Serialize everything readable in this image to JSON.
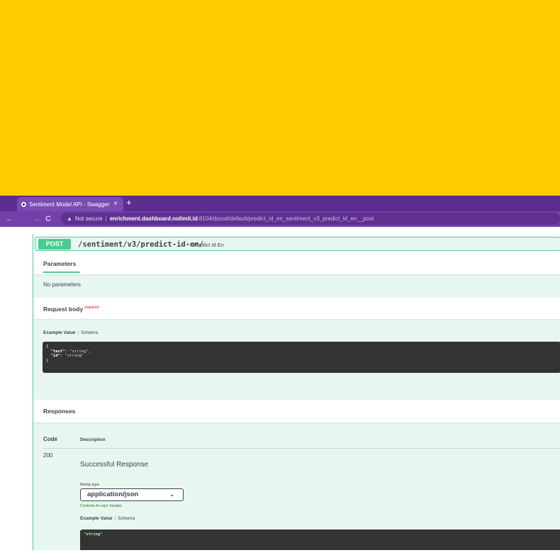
{
  "browser": {
    "tab_title": "Sentiment Model API - Swagger",
    "tab_close": "×",
    "new_tab": "+",
    "back": "←",
    "forward": "→",
    "reload": "C",
    "warning": "▲",
    "not_secure": "Not secure",
    "url_host": "enrichment.dashboard.nolimit.id",
    "url_path": ":8104/docs#/default/predict_id_en_sentiment_v3_predict_id_en__post"
  },
  "operation": {
    "method": "POST",
    "path": "/sentiment/v3/predict-id-en/",
    "summary": "Predict Id En"
  },
  "parameters": {
    "title": "Parameters",
    "empty_text": "No parameters"
  },
  "request_body": {
    "title": "Request body",
    "required_label": "required",
    "example_value_label": "Example Value",
    "divider": "|",
    "schema_label": "Schema",
    "example": {
      "open": "{",
      "close": "}",
      "fields": [
        {
          "key": "\"text\"",
          "value": "\"string\"",
          "trail": ","
        },
        {
          "key": "\"id\"",
          "value": "\"string\"",
          "trail": ""
        }
      ]
    }
  },
  "responses": {
    "title": "Responses",
    "col_code": "Code",
    "col_description": "Description",
    "rows": [
      {
        "code": "200",
        "description": "Successful Response",
        "media_type_label": "Media type",
        "media_type_value": "application/json",
        "controls_prefix": "Controls",
        "controls_code": "Accept",
        "controls_suffix": "header.",
        "example_value_label": "Example Value",
        "schema_label": "Schema",
        "example": "\"string\""
      }
    ]
  },
  "colors": {
    "banner": "#ffcc00",
    "browser_frame": "#5b2d8e",
    "post_green": "#49cc90",
    "op_background": "#e8f6f0",
    "code_background": "#333333"
  }
}
